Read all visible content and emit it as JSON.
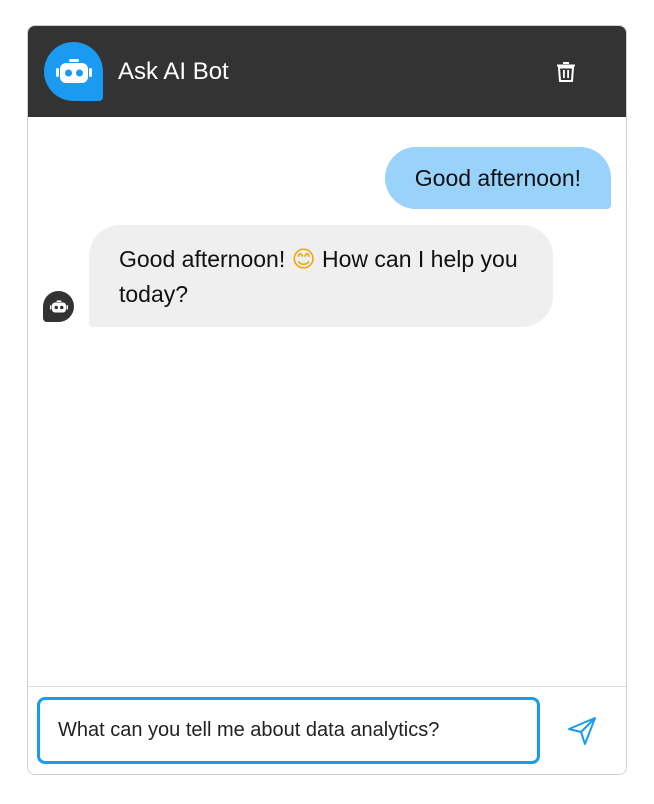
{
  "header": {
    "title": "Ask AI Bot",
    "avatar_icon": "robot-icon",
    "clear_icon": "trash-icon"
  },
  "messages": [
    {
      "sender": "user",
      "text": "Good afternoon!"
    },
    {
      "sender": "bot",
      "text_before_emoji": "Good afternoon!",
      "emoji": "😊",
      "text_after_emoji": "How can I help you today?"
    }
  ],
  "composer": {
    "value": "What can you tell me about data analytics?",
    "send_icon": "send-icon"
  },
  "colors": {
    "header_bg": "#333333",
    "accent": "#1a9af0",
    "user_bubble": "#99d2fa",
    "bot_bubble": "#efefef"
  }
}
